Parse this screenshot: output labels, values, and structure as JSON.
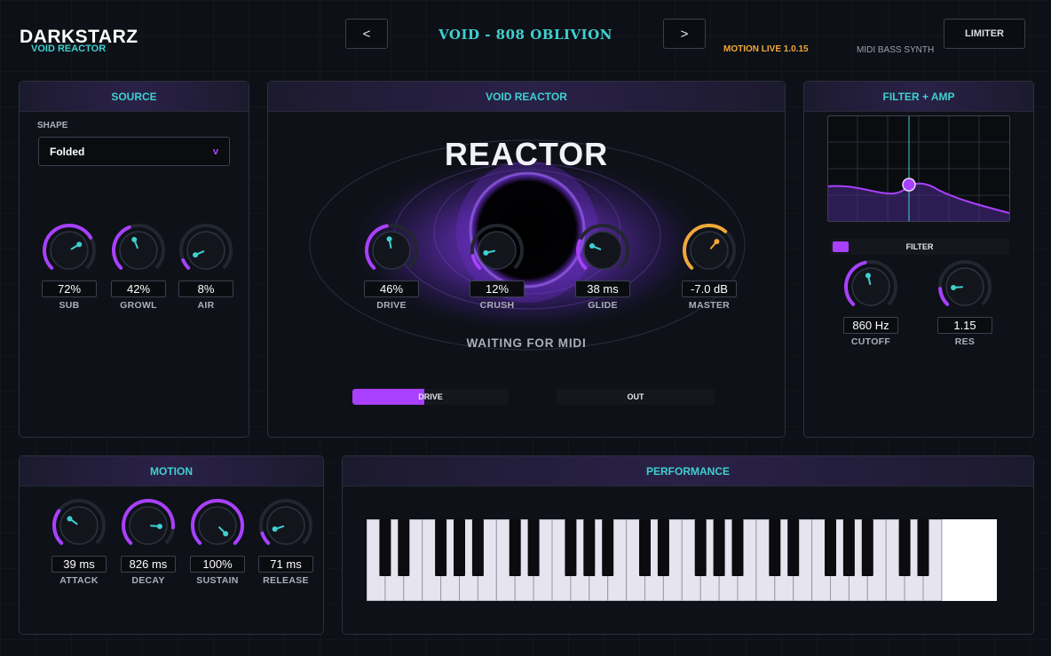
{
  "header": {
    "brand": "DARKSTARZ",
    "subtitle": "VOID REACTOR",
    "prev_label": "<",
    "preset_name": "VOID - 808 OBLIVION",
    "next_label": ">",
    "version": "MOTION LIVE 1.0.15",
    "synth_type": "MIDI BASS SYNTH",
    "limiter_label": "LIMITER"
  },
  "source": {
    "title": "SOURCE",
    "shape_label": "SHAPE",
    "shape_value": "Folded",
    "shape_chevron": "v",
    "knobs": [
      {
        "label": "SUB",
        "value": "72%",
        "level": 0.72
      },
      {
        "label": "GROWL",
        "value": "42%",
        "level": 0.42
      },
      {
        "label": "AIR",
        "value": "8%",
        "level": 0.08
      }
    ]
  },
  "reactor": {
    "title": "VOID REACTOR",
    "heading": "REACTOR",
    "status": "WAITING FOR MIDI",
    "knobs": [
      {
        "label": "DRIVE",
        "value": "46%",
        "level": 0.46
      },
      {
        "label": "CRUSH",
        "value": "12%",
        "level": 0.12
      },
      {
        "label": "GLIDE",
        "value": "38 ms",
        "level": 0.25
      },
      {
        "label": "MASTER",
        "value": "-7.0 dB",
        "level": 0.65
      }
    ],
    "drive_meter": {
      "label": "DRIVE",
      "level": 0.46
    },
    "out_meter": {
      "label": "OUT",
      "level": 0
    }
  },
  "filter": {
    "title": "FILTER + AMP",
    "switch_label": "FILTER",
    "knobs": [
      {
        "label": "CUTOFF",
        "value": "860 Hz",
        "level": 0.45
      },
      {
        "label": "RES",
        "value": "1.15",
        "level": 0.15
      }
    ]
  },
  "motion": {
    "title": "MOTION",
    "knobs": [
      {
        "label": "ATTACK",
        "value": "39 ms",
        "level": 0.3
      },
      {
        "label": "DECAY",
        "value": "826 ms",
        "level": 0.85
      },
      {
        "label": "SUSTAIN",
        "value": "100%",
        "level": 1.0
      },
      {
        "label": "RELEASE",
        "value": "71 ms",
        "level": 0.1
      }
    ]
  },
  "performance": {
    "title": "PERFORMANCE",
    "white_keys": 31
  },
  "colors": {
    "accent_purple": "#a940ff",
    "accent_cyan": "#3fd0d0",
    "accent_orange": "#f0a83a"
  }
}
